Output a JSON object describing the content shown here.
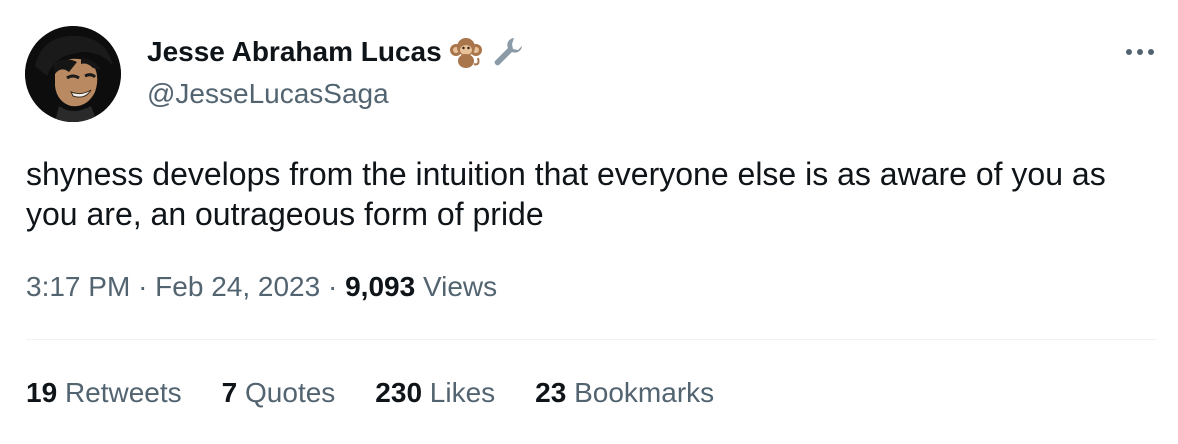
{
  "author": {
    "display_name": "Jesse Abraham Lucas",
    "handle": "@JesseLucasSaga",
    "emojis": [
      "monkey-icon",
      "wrench-icon"
    ]
  },
  "tweet": {
    "text": "shyness develops from the intuition that everyone else is as aware of you as you are, an outrageous form of pride",
    "time": "3:17 PM",
    "separator": "·",
    "date": "Feb 24, 2023",
    "views_count": "9,093",
    "views_label": "Views"
  },
  "stats": [
    {
      "count": "19",
      "label": "Retweets"
    },
    {
      "count": "7",
      "label": "Quotes"
    },
    {
      "count": "230",
      "label": "Likes"
    },
    {
      "count": "23",
      "label": "Bookmarks"
    }
  ],
  "colors": {
    "primary_text": "#0f1419",
    "secondary_text": "#536471",
    "divider": "#eff3f4"
  }
}
